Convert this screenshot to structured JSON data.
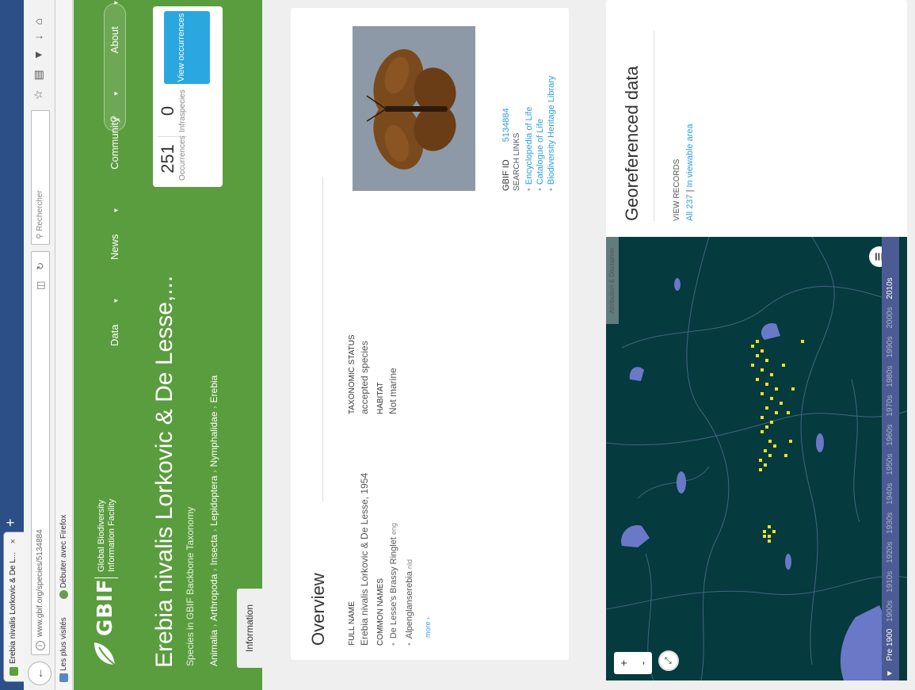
{
  "browser": {
    "tab_title": "Erebia nivalis Lorkovic & De L...",
    "tab_close": "×",
    "new_tab": "+",
    "url": "www.gbif.org/species/5134884",
    "search_placeholder": "Rechercher",
    "bookmark_1": "Les plus visités",
    "bookmark_2": "Débuter avec Firefox"
  },
  "header": {
    "logo_word": "GBIF",
    "logo_org_line1": "Global Biodiversity",
    "logo_org_line2": "Information Facility",
    "nav": [
      "Data",
      "News",
      "Community",
      "About"
    ],
    "title": "Erebia nivalis Lorkovic & De Lesse,...",
    "subtitle": "Species in GBIF Backbone Taxonomy",
    "breadcrumb": [
      "Animalia",
      "Arthropoda",
      "Insecta",
      "Lepidoptera",
      "Nymphalidae",
      "Erebia"
    ],
    "stats": {
      "occurrences_value": "251",
      "occurrences_label": "Occurrences",
      "infraspecies_value": "0",
      "infraspecies_label": "Infraspecies",
      "view_button": "View occurrences"
    },
    "info_tab": "Information"
  },
  "overview": {
    "heading": "Overview",
    "full_name_label": "FULL NAME",
    "full_name_value": "Erebia nivalis Lorkovic & De Lesse, 1954",
    "taxonomic_status_label": "TAXONOMIC STATUS",
    "taxonomic_status_value": "accepted species",
    "common_names_label": "COMMON NAMES",
    "common_names": [
      {
        "name": "De Lesse's Brassy Ringlet",
        "lang": "eng"
      },
      {
        "name": "Alpenglanserebia",
        "lang": "nld"
      }
    ],
    "more_link": "more",
    "habitat_label": "HABITAT",
    "habitat_value": "Not marine",
    "gbif_id_label": "GBIF ID",
    "gbif_id_value": "5134884",
    "search_links_label": "SEARCH LINKS",
    "search_links": [
      "Encyclopedia of Life",
      "Catalogue of Life",
      "Biodiversity Heritage Library"
    ]
  },
  "map": {
    "heading": "Georeferenced data",
    "view_records_label": "VIEW RECORDS",
    "link_all": "All 237",
    "link_viewable": "In viewable area",
    "link_divider": "|",
    "attribution": "Attribution & Disclaimer",
    "zoom_in": "+",
    "zoom_out": "-",
    "timeline": {
      "start": "Pre 1900",
      "decades": [
        "1900s",
        "1910s",
        "1920s",
        "1930s",
        "1940s",
        "1950s",
        "1960s",
        "1970s",
        "1980s",
        "1990s",
        "2000s"
      ],
      "end": "2010s"
    }
  }
}
